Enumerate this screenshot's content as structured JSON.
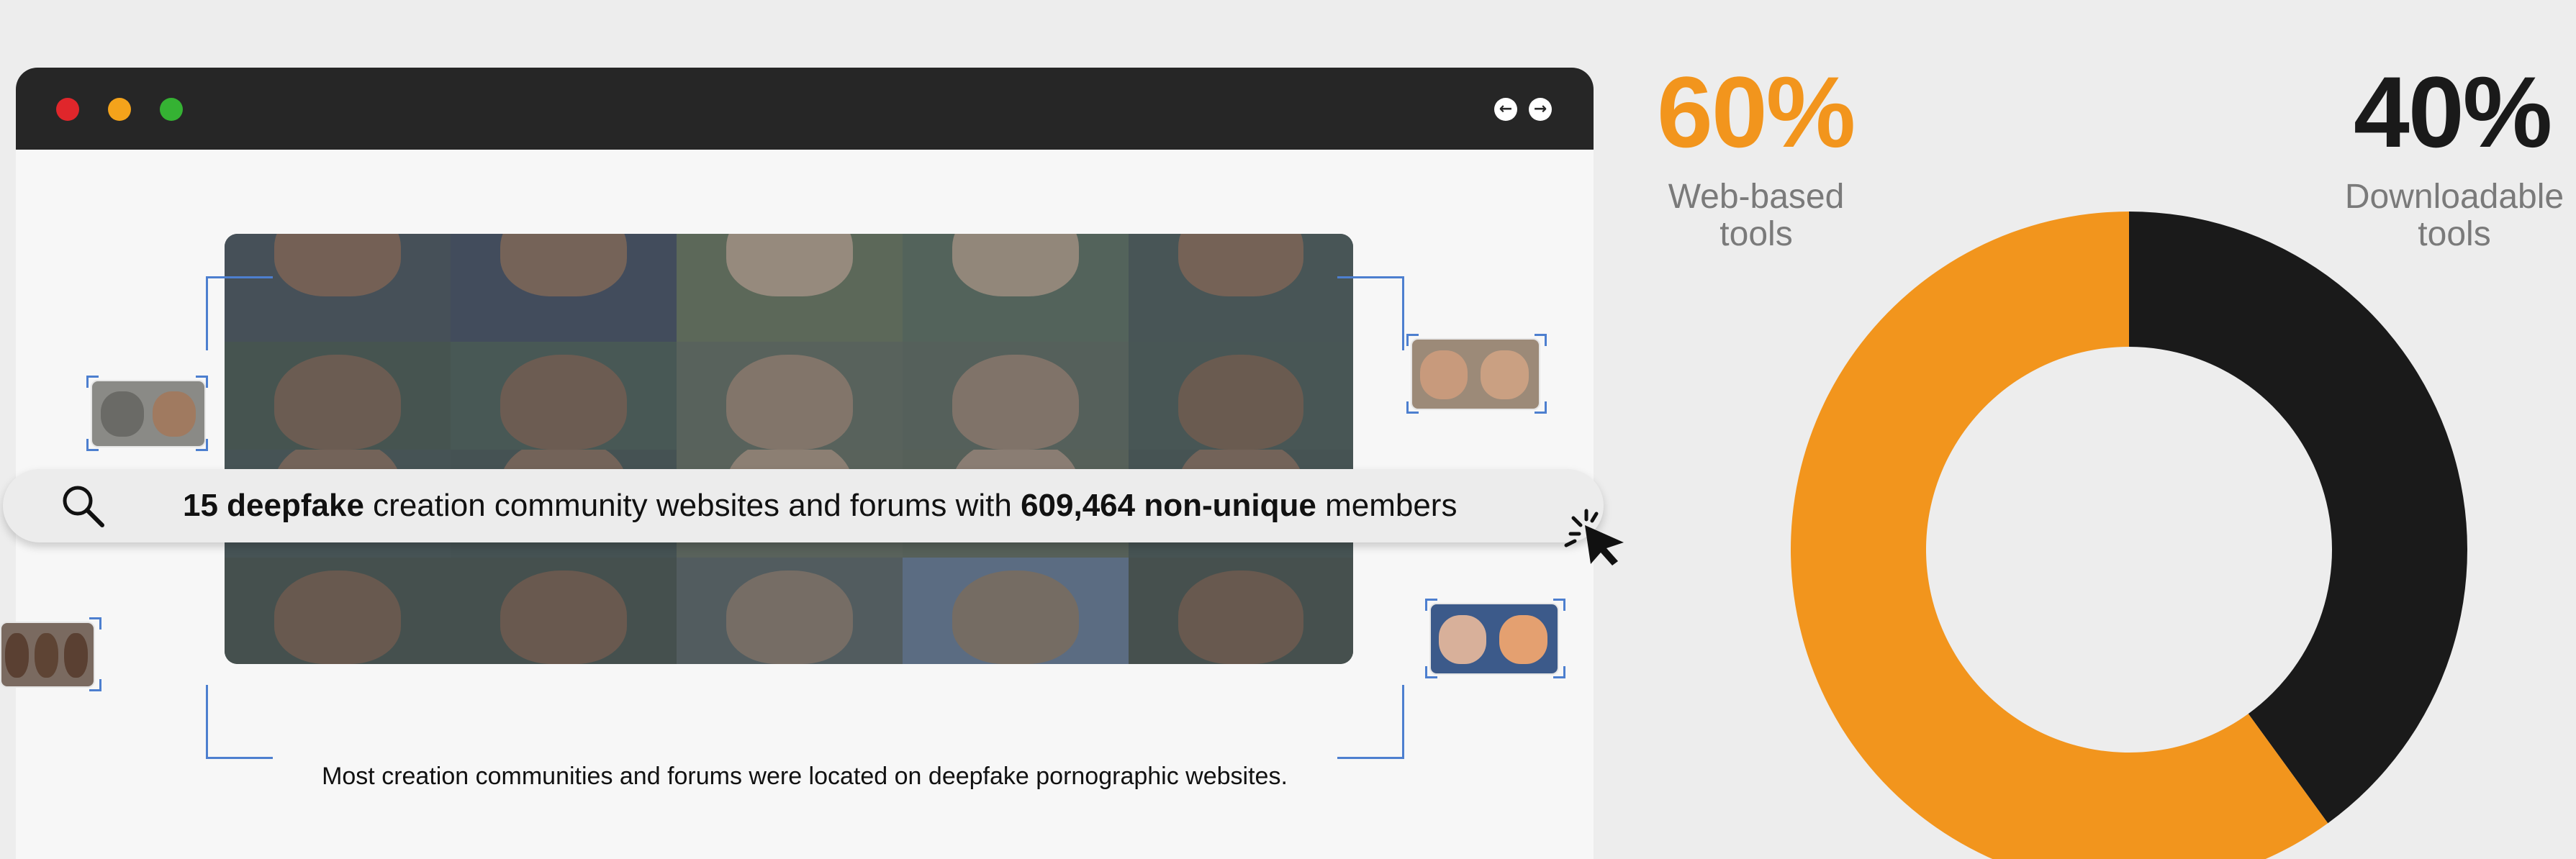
{
  "window": {
    "traffic_lights": {
      "close": "#e0262b",
      "minimize": "#f4a31b",
      "zoom": "#35b233"
    },
    "nav": {
      "back_icon": "←",
      "forward_icon": "→"
    }
  },
  "search": {
    "icon": "search-icon",
    "parts": {
      "count_bold": "15 deepfake",
      "middle": " creation community websites and forums with ",
      "members_bold": "609,464 non-unique",
      "end": " members"
    },
    "cursor_icon": "click-cursor-icon"
  },
  "caption": "Most creation communities and forums were located on deepfake pornographic websites.",
  "stats": {
    "web": {
      "value": "60%",
      "label_line1": "Web-based",
      "label_line2": "tools",
      "color": "#f2951d"
    },
    "download": {
      "value": "40%",
      "label_line1": "Downloadable",
      "label_line2": "tools",
      "color": "#1a1a1a"
    }
  },
  "chart_data": {
    "type": "pie",
    "categories": [
      "Web-based tools",
      "Downloadable tools"
    ],
    "values": [
      60,
      40
    ],
    "colors": [
      "#f2951d",
      "#1a1a1a"
    ],
    "donut": true
  }
}
